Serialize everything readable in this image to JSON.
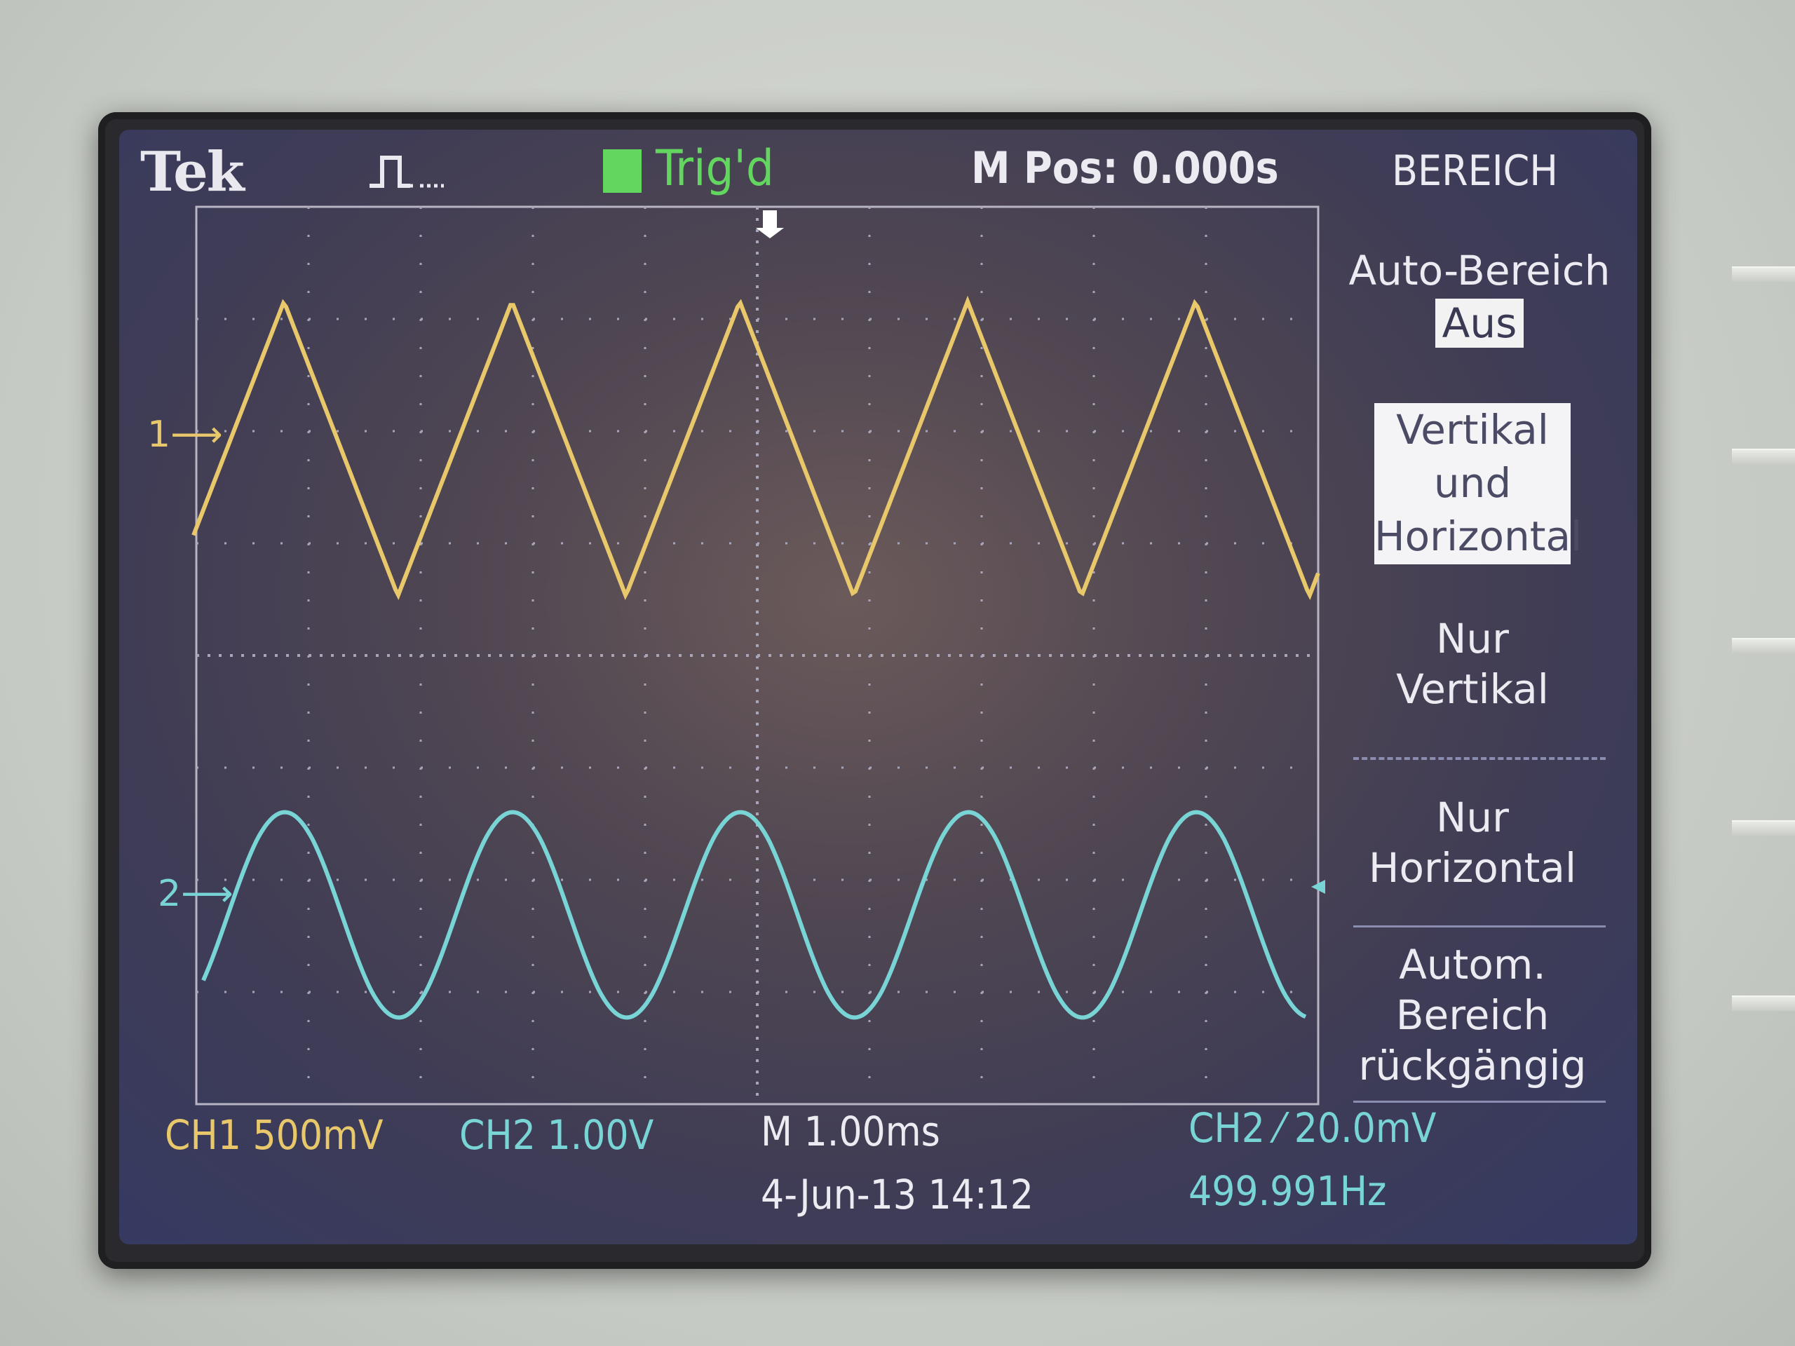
{
  "header": {
    "brand": "Tek",
    "trigger_status": "Trig'd",
    "horizontal_position": "M Pos: 0.000s",
    "menu_title": "BEREICH"
  },
  "menu": {
    "auto_range_label": "Auto-Bereich",
    "auto_range_value": "Aus",
    "vertical_horizontal": [
      "Vertikal",
      "und",
      "Horizontal"
    ],
    "vertical_only": [
      "Nur",
      "Vertikal"
    ],
    "horizontal_only": [
      "Nur",
      "Horizontal"
    ],
    "undo_autorange": [
      "Autom.",
      "Bereich",
      "rückgängig"
    ]
  },
  "channels": {
    "ch1_marker": "1",
    "ch2_marker": "2",
    "ch1_scale": "CH1  500mV",
    "ch2_scale": "CH2  1.00V"
  },
  "footer": {
    "timebase": "M 1.00ms",
    "datetime": "4-Jun-13 14:12",
    "trigger": "CH2 ⁄ 20.0mV",
    "frequency": "499.991Hz"
  },
  "colors": {
    "ch1": "#e8c86a",
    "ch2": "#79d4d6",
    "trigger_green": "#62d65e"
  }
}
